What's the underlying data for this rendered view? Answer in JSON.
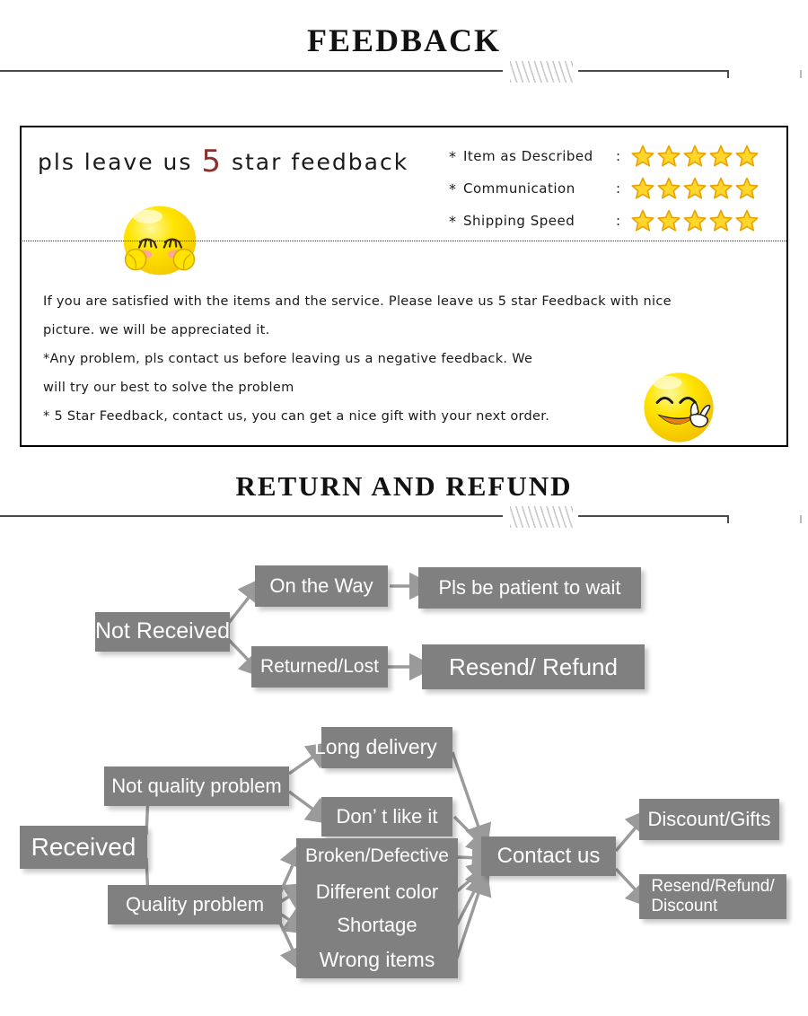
{
  "sections": {
    "feedback_title": "FEEDBACK",
    "return_title": "RETURN AND REFUND"
  },
  "feedback": {
    "headline_prefix": "pls leave us ",
    "headline_number": "5",
    "headline_suffix": " star feedback",
    "ratings": [
      {
        "asterisk": "*",
        "label": "Item as Described",
        "colon": ":",
        "stars": 5
      },
      {
        "asterisk": "*",
        "label": "Communication",
        "colon": ":",
        "stars": 5
      },
      {
        "asterisk": "*",
        "label": "Shipping Speed",
        "colon": ":",
        "stars": 5
      }
    ],
    "body_lines": [
      "If you are satisfied with the items and the service. Please leave us 5 star Feedback with nice",
      "picture. we will be appreciated it.",
      "*Any problem, pls contact us before leaving us a negative feedback. We",
      "will try our best to solve  the problem",
      "* 5 Star Feedback, contact us, you can get a nice gift with your next order."
    ],
    "emoji_shy": "shy-blushing-face-emoji",
    "emoji_peace": "laughing-face-peace-sign-emoji",
    "star_color": "#FFD72B",
    "star_outline": "#E8A200",
    "number_color": "#8C2F2F"
  },
  "flowchart": {
    "node_color": "#808080",
    "text_color": "#FFFFFF",
    "arrow_color": "#9A9A9A",
    "nodes": [
      {
        "id": "not-received",
        "label": "Not Received"
      },
      {
        "id": "on-the-way",
        "label": "On the Way"
      },
      {
        "id": "pls-be-patient",
        "label": "Pls be patient to wait"
      },
      {
        "id": "returned-lost",
        "label": "Returned/Lost"
      },
      {
        "id": "resend-refund",
        "label": "Resend/ Refund"
      },
      {
        "id": "received",
        "label": "Received"
      },
      {
        "id": "not-quality",
        "label": "Not quality problem"
      },
      {
        "id": "long-delivery",
        "label": "Long delivery"
      },
      {
        "id": "dont-like-it",
        "label": "Don’ t like it"
      },
      {
        "id": "quality-problem",
        "label": "Quality problem"
      },
      {
        "id": "broken-defective",
        "label": "Broken/Defective"
      },
      {
        "id": "different-color",
        "label": "Different color"
      },
      {
        "id": "shortage",
        "label": "Shortage"
      },
      {
        "id": "wrong-items",
        "label": "Wrong items"
      },
      {
        "id": "contact-us",
        "label": "Contact us"
      },
      {
        "id": "discount-gifts",
        "label": "Discount/Gifts"
      },
      {
        "id": "resend-refund-discount",
        "label": "Resend/Refund/ Discount"
      }
    ]
  }
}
